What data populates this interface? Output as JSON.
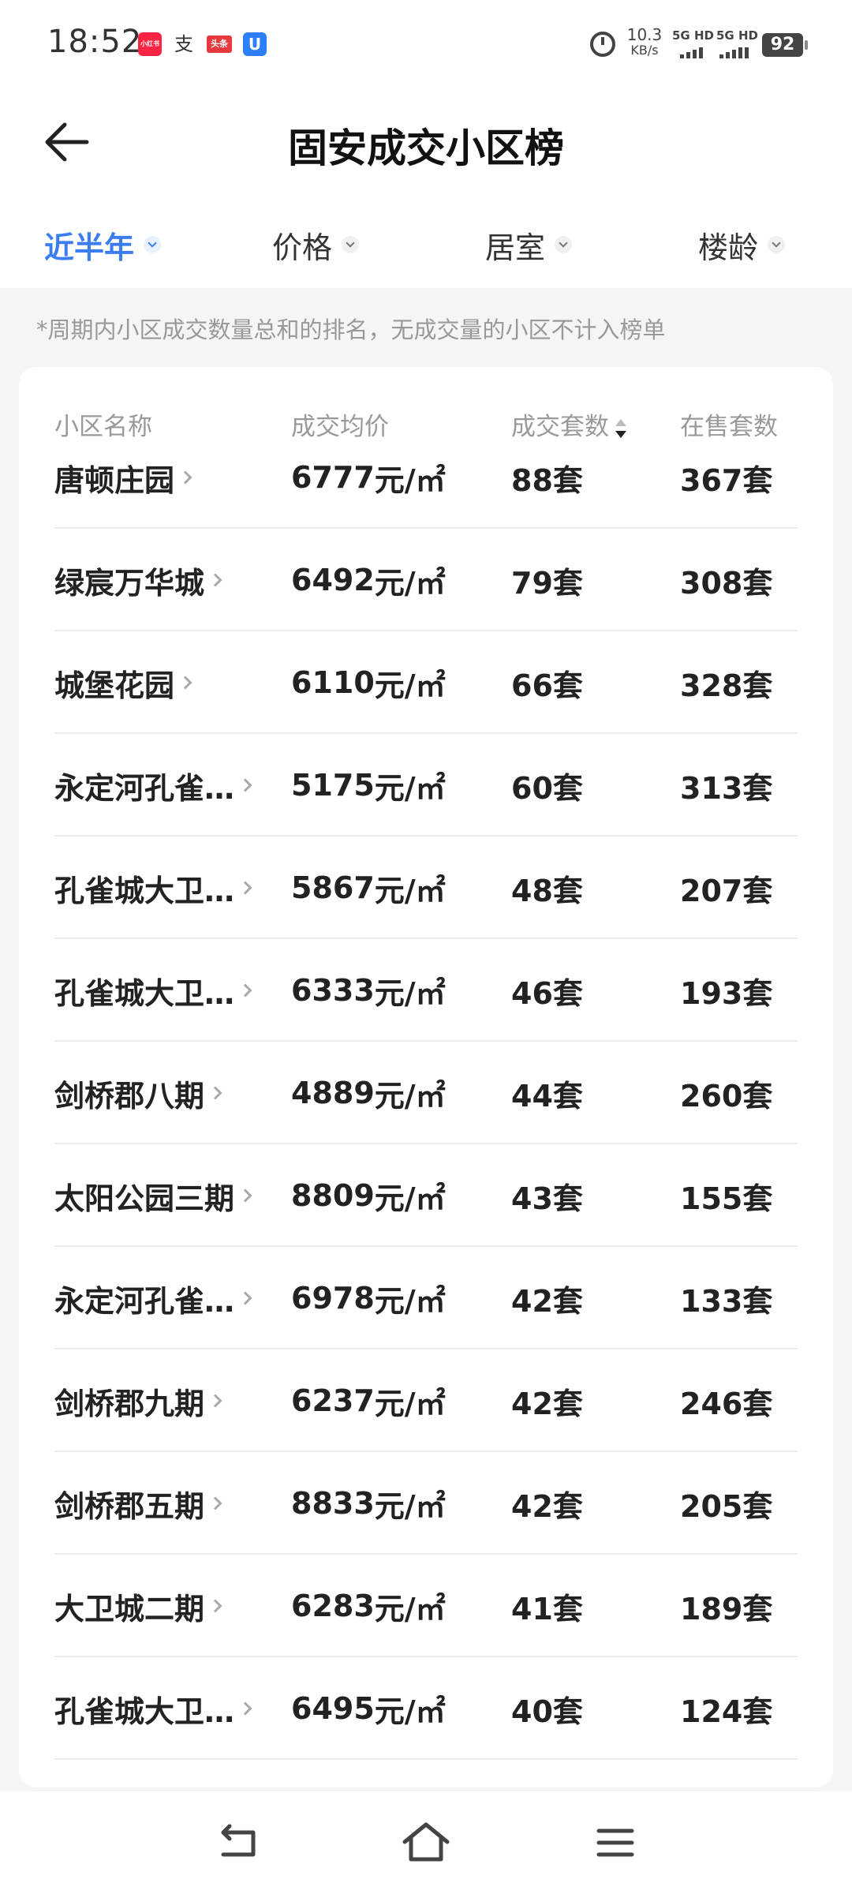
{
  "status_bar": {
    "time": "18:52",
    "app_icons": [
      {
        "name": "xiaohongshu-icon",
        "label": "小红书",
        "color": "#ff2442"
      },
      {
        "name": "alipay-icon",
        "label": "支",
        "color": "#ffffff"
      },
      {
        "name": "toutiao-icon",
        "label": "头条",
        "color": "#e8383d"
      },
      {
        "name": "security-icon",
        "label": "U",
        "color": "#2d7ff9"
      }
    ],
    "net_speed_value": "10.3",
    "net_speed_unit": "KB/s",
    "sim1": "5G HD",
    "sim2": "5G HD",
    "battery": "92"
  },
  "header": {
    "title": "固安成交小区榜",
    "back_icon": "arrow-left-icon"
  },
  "filters": [
    {
      "label": "近半年",
      "active": true
    },
    {
      "label": "价格",
      "active": false
    },
    {
      "label": "居室",
      "active": false
    },
    {
      "label": "楼龄",
      "active": false
    }
  ],
  "note": "*周期内小区成交数量总和的排名，无成交量的小区不计入榜单",
  "table": {
    "headers": {
      "name": "小区名称",
      "avg_price": "成交均价",
      "deals": "成交套数",
      "on_sale": "在售套数"
    },
    "price_unit": "元/㎡",
    "rows": [
      {
        "name": "唐顿庄园",
        "price": "6777",
        "deals": "88套",
        "on_sale": "367套"
      },
      {
        "name": "绿宸万华城",
        "price": "6492",
        "deals": "79套",
        "on_sale": "308套"
      },
      {
        "name": "城堡花园",
        "price": "6110",
        "deals": "66套",
        "on_sale": "328套"
      },
      {
        "name": "永定河孔雀…",
        "price": "5175",
        "deals": "60套",
        "on_sale": "313套"
      },
      {
        "name": "孔雀城大卫…",
        "price": "5867",
        "deals": "48套",
        "on_sale": "207套"
      },
      {
        "name": "孔雀城大卫…",
        "price": "6333",
        "deals": "46套",
        "on_sale": "193套"
      },
      {
        "name": "剑桥郡八期",
        "price": "4889",
        "deals": "44套",
        "on_sale": "260套"
      },
      {
        "name": "太阳公园三期",
        "price": "8809",
        "deals": "43套",
        "on_sale": "155套"
      },
      {
        "name": "永定河孔雀…",
        "price": "6978",
        "deals": "42套",
        "on_sale": "133套"
      },
      {
        "name": "剑桥郡九期",
        "price": "6237",
        "deals": "42套",
        "on_sale": "246套"
      },
      {
        "name": "剑桥郡五期",
        "price": "8833",
        "deals": "42套",
        "on_sale": "205套"
      },
      {
        "name": "大卫城二期",
        "price": "6283",
        "deals": "41套",
        "on_sale": "189套"
      },
      {
        "name": "孔雀城大卫…",
        "price": "6495",
        "deals": "40套",
        "on_sale": "124套"
      }
    ]
  },
  "colors": {
    "accent": "#3b7df0",
    "background": "#f5f5f5",
    "card": "#ffffff"
  },
  "nav_bar": {
    "icons": [
      "back-nav-icon",
      "home-nav-icon",
      "menu-nav-icon"
    ]
  }
}
